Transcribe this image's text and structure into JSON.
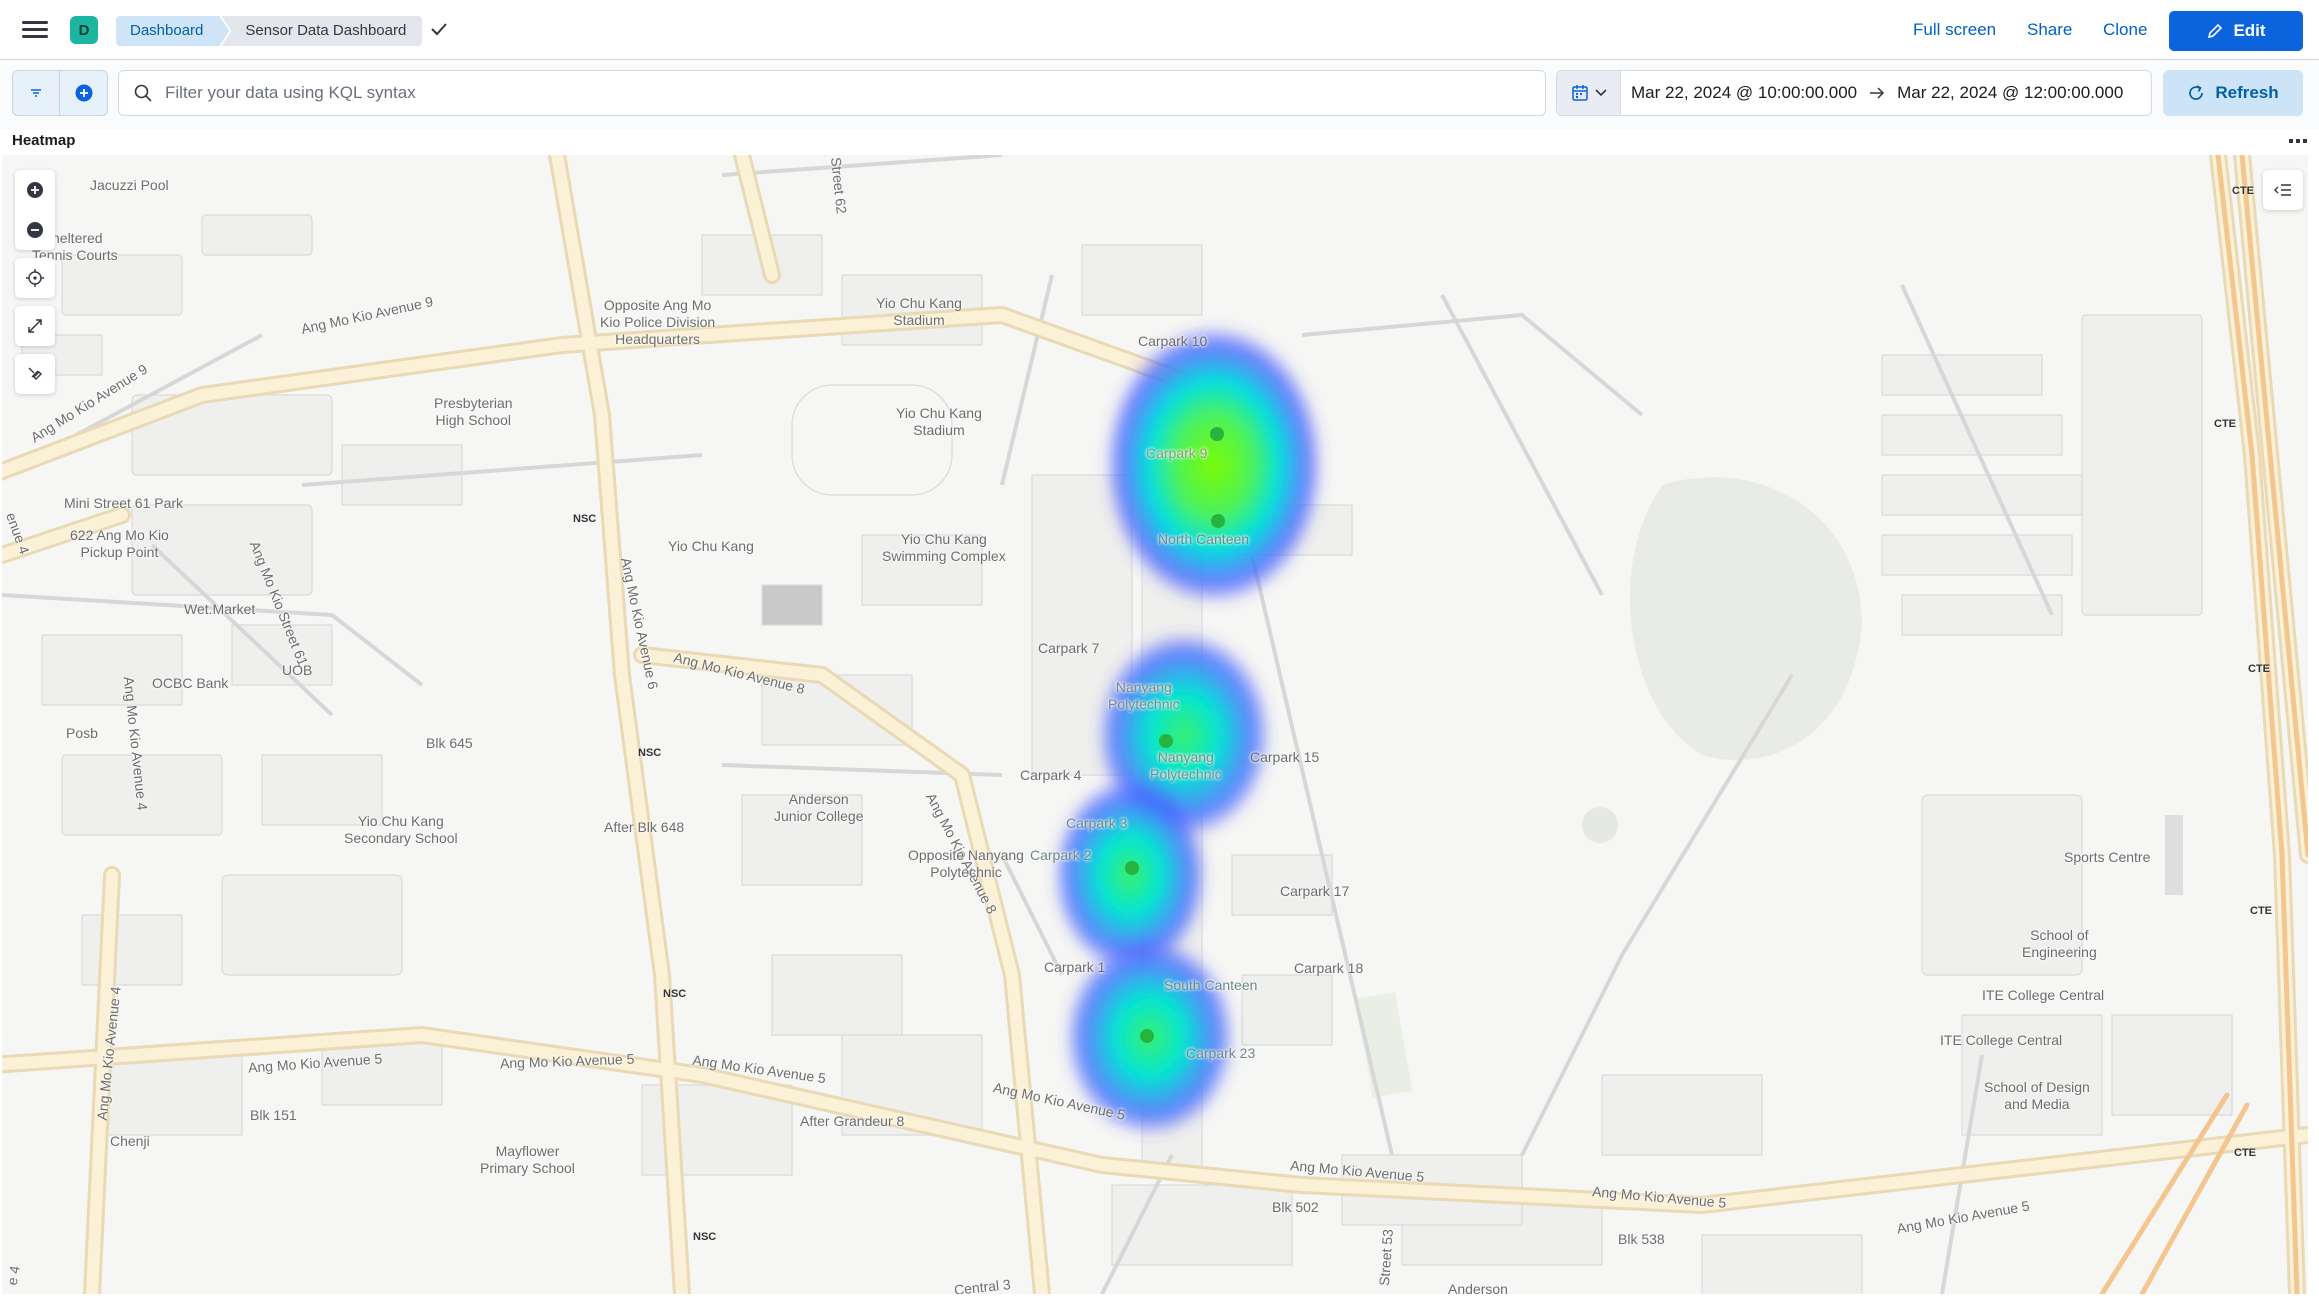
{
  "header": {
    "app_initial": "D",
    "breadcrumbs": [
      "Dashboard",
      "Sensor Data Dashboard"
    ],
    "links": {
      "full_screen": "Full screen",
      "share": "Share",
      "clone": "Clone"
    },
    "edit_label": "Edit"
  },
  "query": {
    "placeholder": "Filter your data using KQL syntax",
    "date_start": "Mar 22, 2024 @ 10:00:00.000",
    "date_end": "Mar 22, 2024 @ 12:00:00.000",
    "refresh_label": "Refresh"
  },
  "panel": {
    "title": "Heatmap"
  },
  "map": {
    "labels": [
      {
        "text": "Jacuzzi Pool"
      },
      {
        "text": "heltered"
      },
      {
        "text": "Tennis Courts"
      },
      {
        "text": "Ang Mo Kio Avenue 9"
      },
      {
        "text": "Ang Mo Kio Avenue 9"
      },
      {
        "text": "Opposite Ang Mo\nKio Police Division\nHeadquarters"
      },
      {
        "text": "Yio Chu Kang\nStadium"
      },
      {
        "text": "Yio Chu Kang\nStadium"
      },
      {
        "text": "Presbyterian\nHigh School"
      },
      {
        "text": "Mini Street 61 Park"
      },
      {
        "text": "622 Ang Mo Kio\nPickup Point"
      },
      {
        "text": "Ang Mo Kio Street 61"
      },
      {
        "text": "Yio Chu Kang"
      },
      {
        "text": "Yio Chu Kang\nSwimming Complex"
      },
      {
        "text": "Ang Mo Kio Avenue 6"
      },
      {
        "text": "Wet.Market"
      },
      {
        "text": "Ang Mo Kio Avenue 8"
      },
      {
        "text": "Ang Mo Kio Avenue 4"
      },
      {
        "text": "OCBC Bank"
      },
      {
        "text": "UOB"
      },
      {
        "text": "Posb"
      },
      {
        "text": "Blk 645"
      },
      {
        "text": "Ang Mo Kio Avenue 8"
      },
      {
        "text": "Anderson\nJunior College"
      },
      {
        "text": "After Blk 648"
      },
      {
        "text": "Yio Chu Kang\nSecondary School"
      },
      {
        "text": "Opposite Nanyang\nPolytechnic"
      },
      {
        "text": "Ang Mo Kio Avenue 4"
      },
      {
        "text": "Ang Mo Kio Avenue 5"
      },
      {
        "text": "Ang Mo Kio Avenue 5"
      },
      {
        "text": "Ang Mo Kio Avenue 5"
      },
      {
        "text": "Blk 151"
      },
      {
        "text": "Chenji"
      },
      {
        "text": "After Grandeur 8"
      },
      {
        "text": "Ang Mo Kio Avenue 5"
      },
      {
        "text": "Mayflower\nPrimary School"
      },
      {
        "text": "Ang Mo Kio Avenue 5"
      },
      {
        "text": "Ang Mo Kio Avenue 5"
      },
      {
        "text": "Ang Mo Kio Avenue 5"
      },
      {
        "text": "Blk 502"
      },
      {
        "text": "Blk 538"
      },
      {
        "text": "Street 53"
      },
      {
        "text": "Street 62"
      },
      {
        "text": "Carpark 10"
      },
      {
        "text": "Carpark 9"
      },
      {
        "text": "North Canteen"
      },
      {
        "text": "Carpark 7"
      },
      {
        "text": "Nanyang\nPolytechnic"
      },
      {
        "text": "Nanyang\nPolytechnic"
      },
      {
        "text": "Carpark 15"
      },
      {
        "text": "Carpark 4"
      },
      {
        "text": "Carpark 3"
      },
      {
        "text": "Carpark 2"
      },
      {
        "text": "Carpark 17"
      },
      {
        "text": "Carpark 1"
      },
      {
        "text": "Carpark 18"
      },
      {
        "text": "South Canteen"
      },
      {
        "text": "Carpark 23"
      },
      {
        "text": "Sports Centre"
      },
      {
        "text": "School of\nEngineering"
      },
      {
        "text": "ITE College Central"
      },
      {
        "text": "ITE College Central"
      },
      {
        "text": "School of Design\nand Media"
      },
      {
        "text": "Anderson"
      },
      {
        "text": "Central 3"
      },
      {
        "text": "enue 4"
      },
      {
        "text": "e 4"
      }
    ],
    "nsc_markers": [
      "NSC",
      "NSC",
      "NSC",
      "NSC"
    ],
    "cte_markers": [
      "CTE",
      "CTE",
      "CTE",
      "CTE",
      "CTE"
    ]
  },
  "colors": {
    "accent": "#0b64dd",
    "breadcrumb_active": "#cfe4f6",
    "heat_low": "#3b3bff",
    "heat_mid": "#00e5e5",
    "heat_high": "#7cfc00"
  }
}
